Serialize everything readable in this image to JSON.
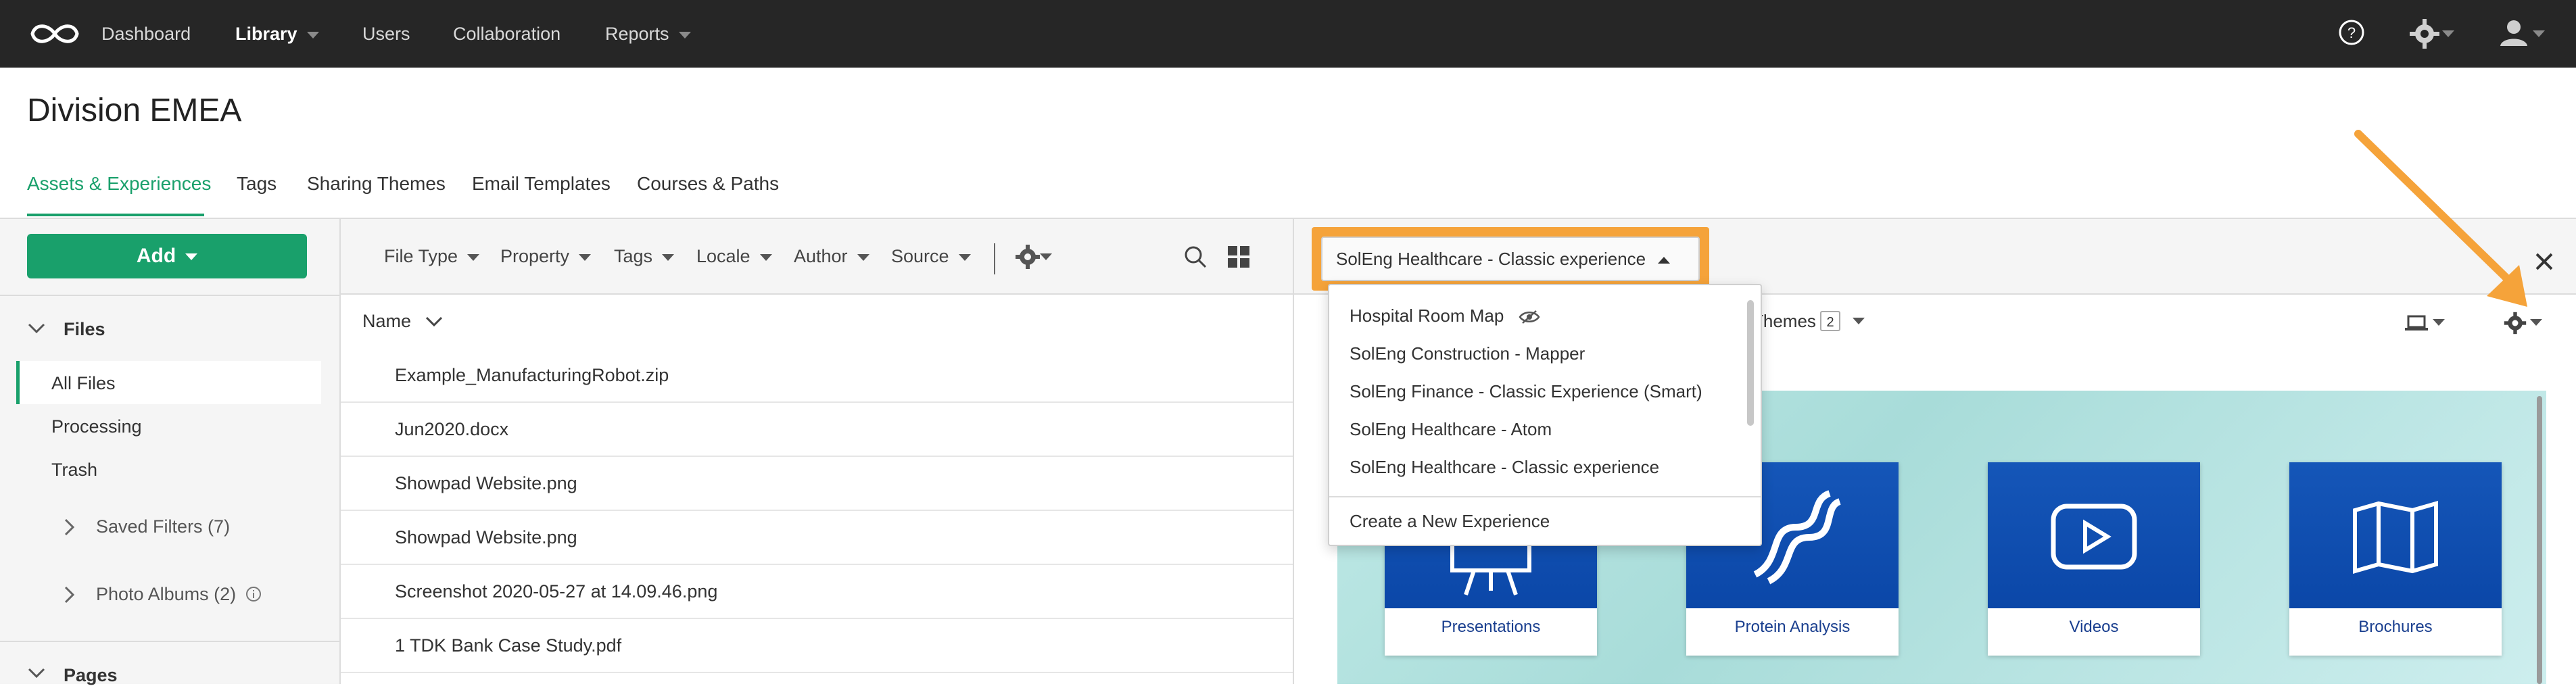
{
  "topnav": {
    "items": [
      "Dashboard",
      "Library",
      "Users",
      "Collaboration",
      "Reports"
    ],
    "help_icon": "help-circle-icon",
    "settings_icon": "gear-icon",
    "user_icon": "user-avatar-icon"
  },
  "page": {
    "title": "Division EMEA",
    "tabs": [
      "Assets & Experiences",
      "Tags",
      "Sharing Themes",
      "Email Templates",
      "Courses & Paths"
    ],
    "active_tab": "Assets & Experiences"
  },
  "sidebar": {
    "add_label": "Add",
    "files_heading": "Files",
    "items": [
      "All Files",
      "Processing",
      "Trash"
    ],
    "saved_filters": "Saved Filters (7)",
    "photo_albums": "Photo Albums (2)",
    "pages_heading": "Pages"
  },
  "filters": [
    "File Type",
    "Property",
    "Tags",
    "Locale",
    "Author",
    "Source"
  ],
  "table": {
    "column_name": "Name",
    "rows": [
      "Example_ManufacturingRobot.zip",
      "Jun2020.docx",
      "Showpad Website.png",
      "Showpad Website.png",
      "Screenshot 2020-05-27 at 14.09.46.png",
      "1 TDK Bank Case Study.pdf"
    ]
  },
  "experience": {
    "selected": "SolEng Healthcare - Classic experience",
    "options": [
      "Hospital Room Map",
      "SolEng Construction - Mapper",
      "SolEng Finance - Classic Experience (Smart)",
      "SolEng Healthcare - Atom",
      "SolEng Healthcare - Classic experience"
    ],
    "create_label": "Create a New Experience",
    "themes_label": "Themes",
    "themes_count": "2"
  },
  "tiles": [
    "Presentations",
    "Protein Analysis",
    "Videos",
    "Brochures"
  ],
  "colors": {
    "accent": "#19a06b",
    "highlight": "#f5a33a",
    "topbar": "#262626",
    "tile_blue": "#0b47a8"
  }
}
